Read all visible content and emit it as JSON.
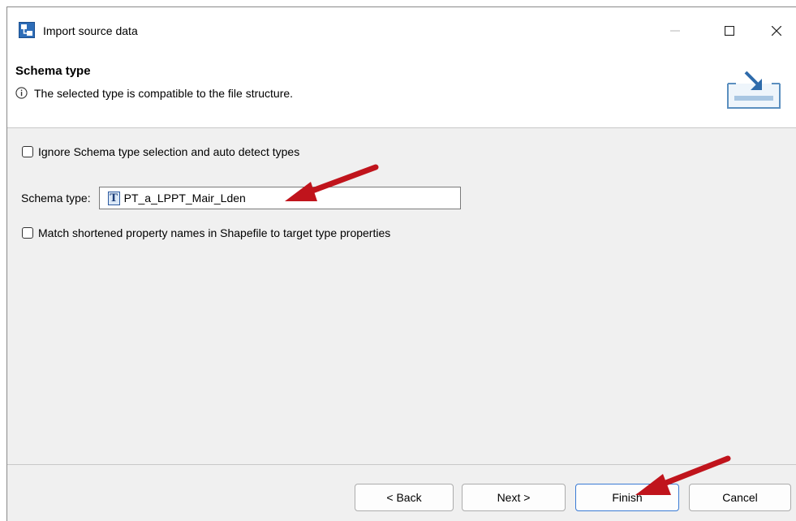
{
  "window": {
    "title": "Import source data"
  },
  "header": {
    "title": "Schema type",
    "message": "The selected type is compatible to the file structure."
  },
  "content": {
    "ignore_label": "Ignore Schema type selection and auto detect types",
    "ignore_checked": false,
    "schema_label": "Schema type:",
    "schema_value": "PT_a_LPPT_Mair_Lden",
    "match_label": "Match shortened property names in Shapefile to target type properties",
    "match_checked": false
  },
  "footer": {
    "back_label": "< Back",
    "next_label": "Next >",
    "finish_label": "Finish",
    "cancel_label": "Cancel"
  },
  "colors": {
    "arrow": "#c0141c",
    "focus": "#3a7bd5"
  },
  "icons": [
    "app-icon",
    "minimize-icon",
    "maximize-icon",
    "close-icon",
    "info-icon",
    "import-wizard-banner-icon",
    "type-icon",
    "annotation-arrow"
  ]
}
